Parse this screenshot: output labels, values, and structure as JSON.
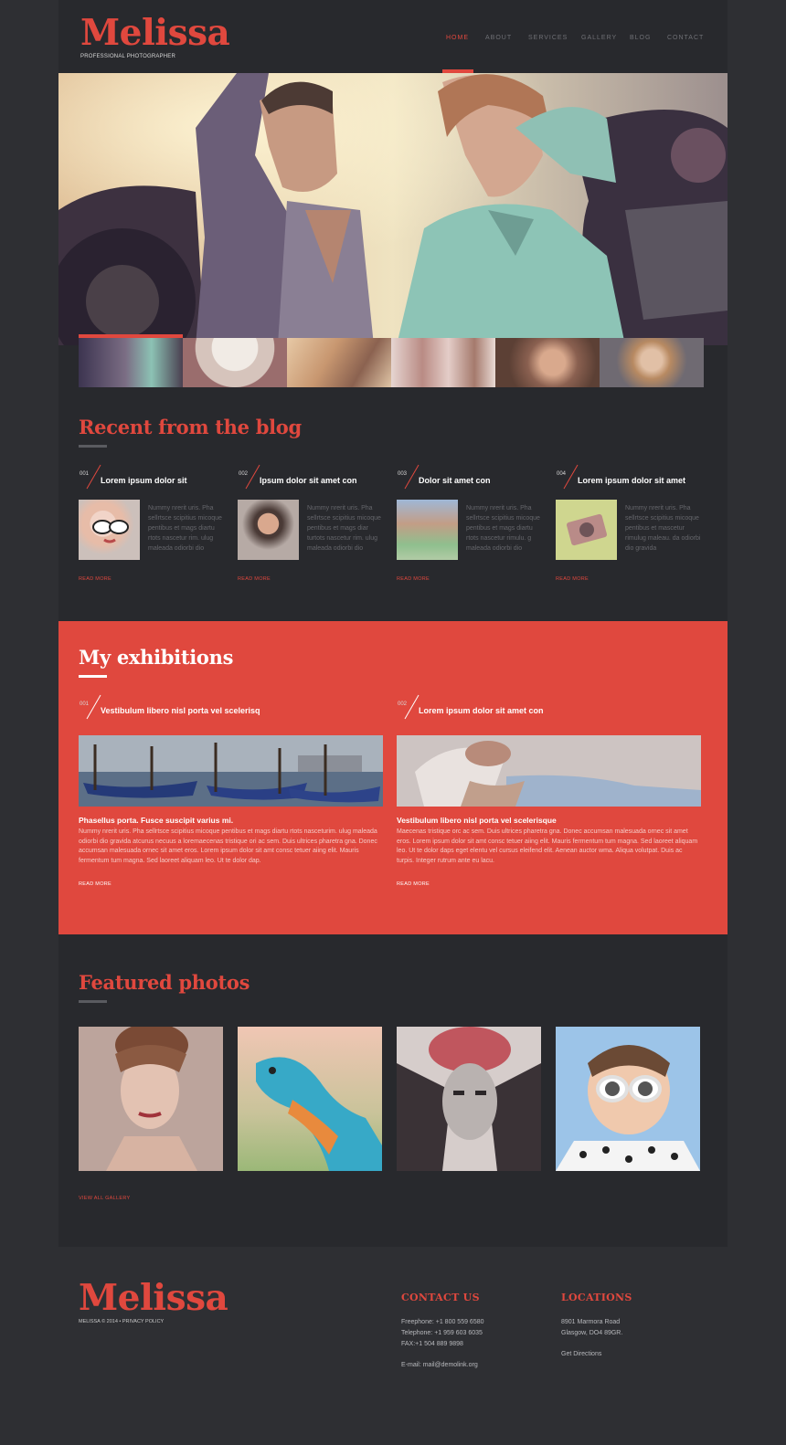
{
  "header": {
    "logo": "Melissa",
    "tagline": "PROFESSIONAL PHOTOGRAPHER",
    "nav": [
      "HOME",
      "ABOUT",
      "SERVICES",
      "GALLERY",
      "BLOG",
      "CONTACT"
    ],
    "active_nav": "HOME"
  },
  "blog": {
    "title": "Recent from the blog",
    "posts": [
      {
        "num": "001",
        "title": "Lorem ipsum dolor sit",
        "text": "Nummy nrerit uris. Pha sellrtsce scipitius micoque pentibus et mags diartu rtots nascetur rim. ulug maleada odiorbi dio",
        "read_more": "READ MORE"
      },
      {
        "num": "002",
        "title": "Ipsum dolor sit amet con",
        "text": "Nummy nrerit uris. Pha sellrtsce scipitius micoque pentibus et mags diar turtots nascetur rim. ulug maleada odiorbi dio",
        "read_more": "READ MORE"
      },
      {
        "num": "003",
        "title": "Dolor sit amet con",
        "text": "Nummy nrerit uris. Pha sellrtsce scipitius micoque pentibus et mags diartu rtots nascetur rimulu. g maleada odiorbi dio",
        "read_more": "READ MORE"
      },
      {
        "num": "004",
        "title": "Lorem ipsum dolor sit amet",
        "text": "Nummy nrerit uris. Pha sellrtsce scipitius micoque pentibus et mascetur rimulug maleau. da odiorbi dio gravida",
        "read_more": "READ MORE"
      }
    ]
  },
  "exhibitions": {
    "title": "My exhibitions",
    "items": [
      {
        "num": "001",
        "title": "Vestibulum libero nisl porta vel scelerisq",
        "subtitle": "Phasellus porta. Fusce suscipit varius mi.",
        "text": "Nummy nrerit uris. Pha sellrtsce scipitius micoque pentibus et mags diartu rtots nasceturim. ulug maleada odiorbi dio gravida atcurus necuus a loremaecenas tristique ori ac sem. Duis ultrices pharetra gna. Donec accumsan malesuada ornec sit amet eros. Lorem ipsum dolor sit amt consc tetuer aiing elit. Mauris fermentum tum magna. Sed laoreet aliquam leo. Ut te dolor dap.",
        "read_more": "READ MORE"
      },
      {
        "num": "002",
        "title": "Lorem ipsum dolor sit amet con",
        "subtitle": "Vestibulum libero nisl porta vel scelerisque",
        "text": "Maecenas tristique orc ac sem. Duis ultrices pharetra gna. Donec accumsan malesuada ornec sit amet eros. Lorem ipsum dolor sit amt consc tetuer aiing elit. Mauris fermentum tum magna. Sed laoreet aliquam leo. Ut te dolor daps eget elentu vel cursus eleifend elit. Aenean auctor wma. Aliqua volutpat. Duis ac turpis. Integer rutrum ante eu lacu.",
        "read_more": "READ MORE"
      }
    ]
  },
  "featured": {
    "title": "Featured photos",
    "view_all": "VIEW ALL GALLERY"
  },
  "footer": {
    "logo": "Melissa",
    "copyright": "MELISSA © 2014 • PRIVACY POLICY",
    "contact_title": "CONTACT US",
    "contact_lines": [
      "Freephone:   +1 800 559 6580",
      "Telephone:   +1 959 603 6035",
      "FAX:+1 504 889 9898"
    ],
    "email": "E-mail: mail@demolink.org",
    "locations_title": "LOCATIONS",
    "address_lines": [
      "8901 Marmora Road",
      "Glasgow, DO4 89GR."
    ],
    "directions": "Get Directions"
  },
  "colors": {
    "accent": "#e0483e",
    "background": "#2e2f33",
    "panel": "#28292d"
  }
}
